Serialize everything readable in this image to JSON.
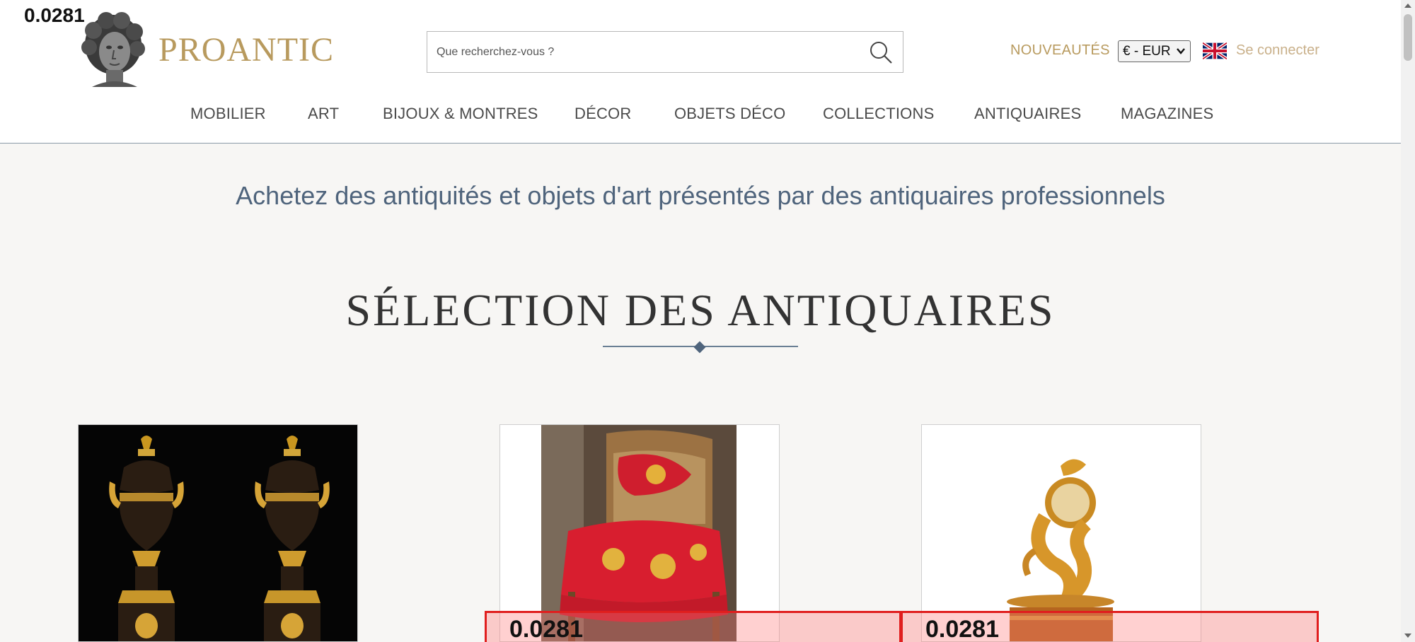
{
  "overlay_scores": {
    "top": "0.0281",
    "card2": "0.0281",
    "card3": "0.0281"
  },
  "header": {
    "logo_text": "PROANTIC",
    "search": {
      "placeholder": "Que recherchez-vous ?",
      "icon": "search-icon"
    },
    "nouveautes": "NOUVEAUTÉS",
    "currency": "€ - EUR",
    "language_flag": "uk-flag-icon",
    "login": "Se connecter"
  },
  "nav": {
    "items": [
      {
        "label": "MOBILIER"
      },
      {
        "label": "ART"
      },
      {
        "label": "BIJOUX & MONTRES"
      },
      {
        "label": "DÉCOR"
      },
      {
        "label": "OBJETS DÉCO"
      },
      {
        "label": "COLLECTIONS"
      },
      {
        "label": "ANTIQUAIRES"
      },
      {
        "label": "MAGAZINES"
      }
    ]
  },
  "main": {
    "tagline": "Achetez des antiquités et objets d'art présentés par des antiquaires professionnels",
    "section_title": "SÉLECTION DES ANTIQUAIRES"
  },
  "colors": {
    "brand_gold": "#b89a5e",
    "login_gold": "#c9b08a",
    "tagline_blue": "#4f647c",
    "background": "#f7f6f4",
    "overlay_red": "#e01e1e"
  }
}
